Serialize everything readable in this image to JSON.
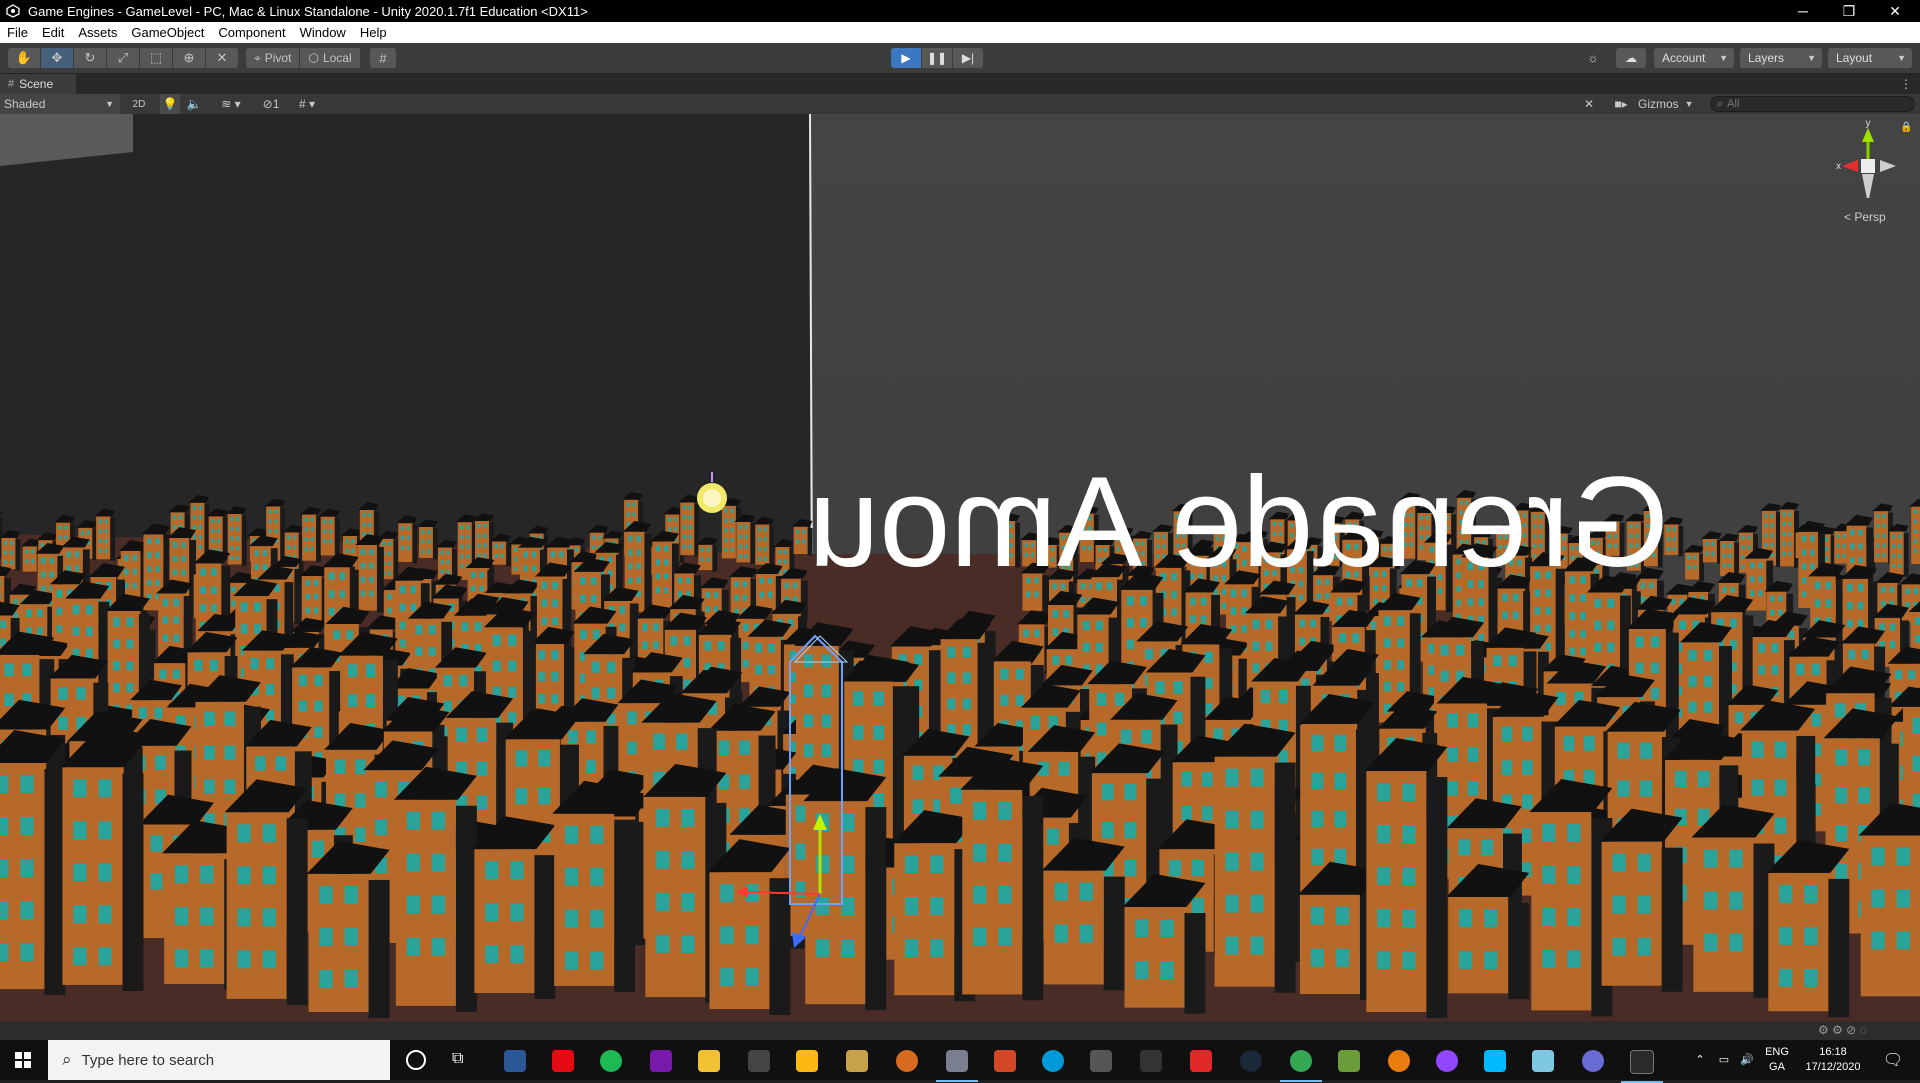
{
  "window": {
    "title": "Game Engines - GameLevel - PC, Mac & Linux Standalone - Unity 2020.1.7f1 Education <DX11>",
    "controls": {
      "minimize": "─",
      "restore": "❐",
      "close": "✕"
    }
  },
  "menu": [
    "File",
    "Edit",
    "Assets",
    "GameObject",
    "Component",
    "Window",
    "Help"
  ],
  "toolbar": {
    "tools": [
      "hand-icon",
      "move-icon",
      "rotate-icon",
      "scale-icon",
      "rect-icon",
      "transform-icon",
      "custom-tool-icon"
    ],
    "pivot_label": "Pivot",
    "local_label": "Local",
    "account_label": "Account",
    "layers_label": "Layers",
    "layout_label": "Layout"
  },
  "scene_tab": {
    "label": "Scene"
  },
  "scene_toolbar": {
    "shading_mode": "Shaded",
    "mode_2d": "2D",
    "layer_count": "1",
    "gizmos_label": "Gizmos",
    "search_placeholder": "All"
  },
  "viewport": {
    "world_text": "Grenade Amou",
    "axis_y": "y",
    "axis_x": "x",
    "projection": "< Persp"
  },
  "taskbar": {
    "search_placeholder": "Type here to search",
    "language_1": "ENG",
    "language_2": "GA",
    "time": "16:18",
    "date": "17/12/2020"
  },
  "colors": {
    "editor_dark": "#3c3c3c",
    "play_active": "#3a78c2",
    "house_wall": "#b7692a",
    "house_roof": "#111111",
    "window": "#2aa39a",
    "ground": "#4a2c27",
    "sky": "#3f3f3f"
  }
}
